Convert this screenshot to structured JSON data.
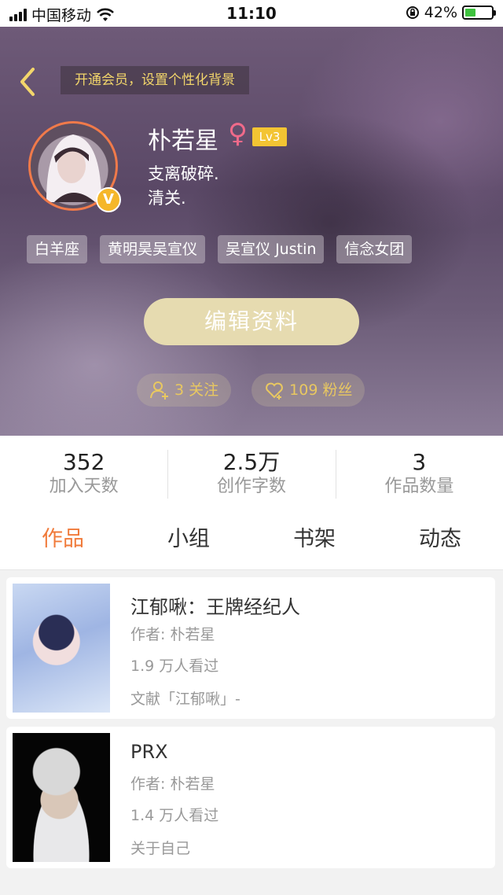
{
  "status_bar": {
    "carrier": "中国移动",
    "time": "11:10",
    "battery": "42%",
    "battery_level": 0.42
  },
  "header": {
    "vip_banner": "开通会员，设置个性化背景",
    "username": "朴若星",
    "gender_symbol": "♀",
    "level": "Lv3",
    "avatar_badge": "V",
    "bio_lines": [
      "支离破碎.",
      "清关."
    ],
    "tags": [
      "白羊座",
      "黄明昊吴宣仪",
      "吴宣仪 Justin",
      "信念女团"
    ],
    "edit_button": "编辑资料",
    "following": "3 关注",
    "followers": "109 粉丝"
  },
  "stats": [
    {
      "value": "352",
      "label": "加入天数"
    },
    {
      "value": "2.5万",
      "label": "创作字数"
    },
    {
      "value": "3",
      "label": "作品数量"
    }
  ],
  "tabs": [
    {
      "label": "作品",
      "active": true
    },
    {
      "label": "小组",
      "active": false
    },
    {
      "label": "书架",
      "active": false
    },
    {
      "label": "动态",
      "active": false
    }
  ],
  "works": [
    {
      "title": "江郁啾：王牌经纪人",
      "author": "作者: 朴若星",
      "views": "1.9 万人看过",
      "tag": "文献「江郁啾」-"
    },
    {
      "title": "PRX",
      "author": "作者: 朴若星",
      "views": "1.4 万人看过",
      "tag": "关于自己"
    }
  ],
  "colors": {
    "accent": "#f07a3a",
    "gold": "#e9c860",
    "edit_button": "#e6dbb0",
    "level_badge": "#f3c433"
  }
}
